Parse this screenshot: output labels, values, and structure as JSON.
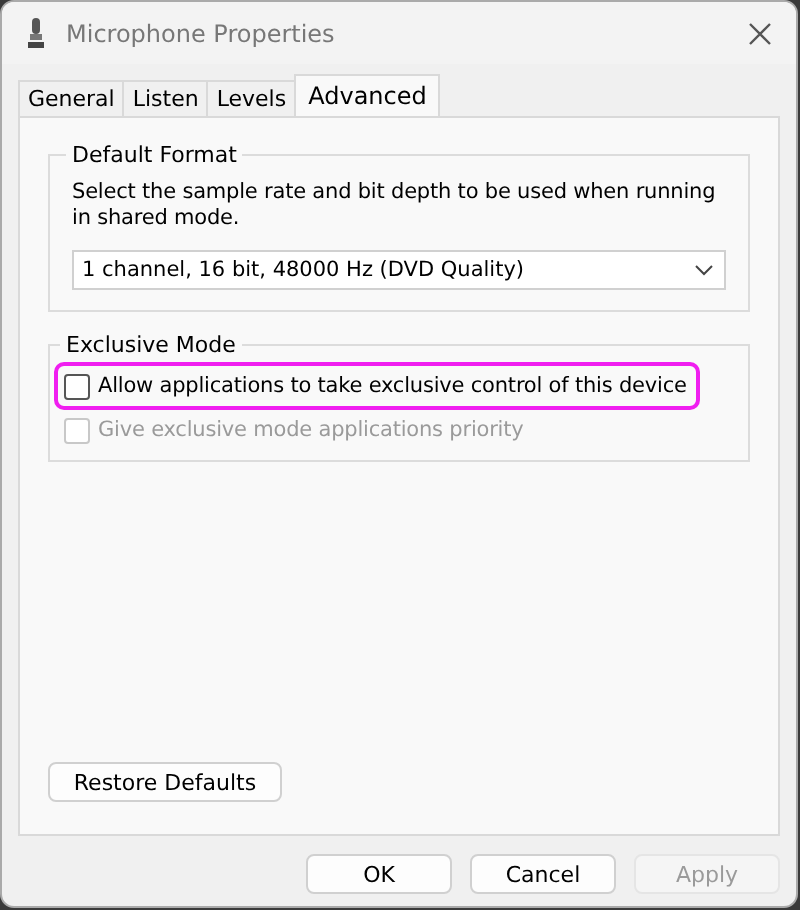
{
  "window": {
    "title": "Microphone Properties"
  },
  "tabs": [
    {
      "label": "General",
      "selected": false
    },
    {
      "label": "Listen",
      "selected": false
    },
    {
      "label": "Levels",
      "selected": false
    },
    {
      "label": "Advanced",
      "selected": true
    }
  ],
  "default_format": {
    "title": "Default Format",
    "description": "Select the sample rate and bit depth to be used when running in shared mode.",
    "dropdown": {
      "value": "1 channel, 16 bit, 48000 Hz (DVD Quality)"
    }
  },
  "exclusive_mode": {
    "title": "Exclusive Mode",
    "options": [
      {
        "label": "Allow applications to take exclusive control of this device",
        "checked": false,
        "disabled": false,
        "highlighted": true
      },
      {
        "label": "Give exclusive mode applications priority",
        "checked": false,
        "disabled": true,
        "highlighted": false
      }
    ]
  },
  "restore_button": "Restore Defaults",
  "buttons": [
    {
      "label": "OK",
      "disabled": false
    },
    {
      "label": "Cancel",
      "disabled": false
    },
    {
      "label": "Apply",
      "disabled": true
    }
  ]
}
